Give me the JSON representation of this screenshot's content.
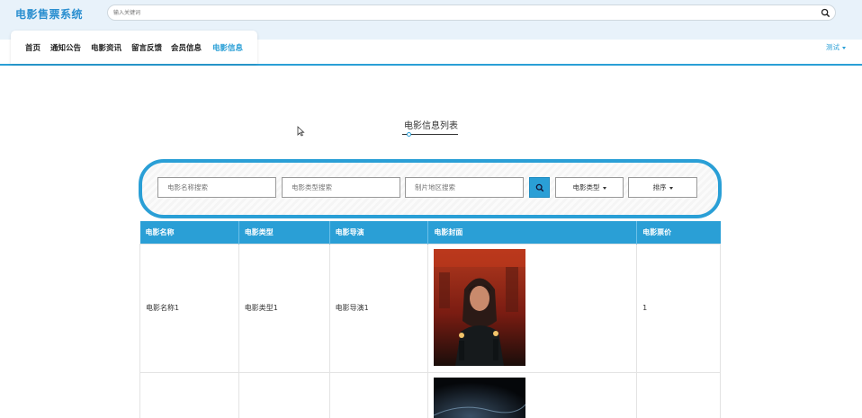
{
  "app": {
    "brand": "电影售票系统"
  },
  "search": {
    "placeholder": "输入关键词"
  },
  "nav": {
    "items": [
      {
        "label": "首页"
      },
      {
        "label": "通知公告"
      },
      {
        "label": "电影资讯"
      },
      {
        "label": "留言反馈"
      },
      {
        "label": "会员信息"
      },
      {
        "label": "电影信息"
      }
    ],
    "active_index": 5,
    "user": "测试"
  },
  "page": {
    "title": "电影信息列表"
  },
  "filters": {
    "name_placeholder": "电影名称搜索",
    "type_placeholder": "电影类型搜索",
    "region_placeholder": "制片地区搜索",
    "type_dropdown": "电影类型",
    "sort_dropdown": "排序"
  },
  "table": {
    "headers": [
      "电影名称",
      "电影类型",
      "电影导演",
      "电影封面",
      "电影票价"
    ],
    "rows": [
      {
        "name": "电影名称1",
        "type": "电影类型1",
        "director": "电影导演1",
        "price": "1"
      },
      {
        "name": "",
        "type": "",
        "director": "",
        "price": ""
      }
    ]
  },
  "colors": {
    "accent": "#2a9fd6",
    "brand": "#2b8fd0",
    "topbar_bg": "#e8f2fa"
  },
  "icons": {
    "search": "search-icon",
    "caret": "caret-down-icon",
    "cursor": "mouse-cursor-icon"
  }
}
